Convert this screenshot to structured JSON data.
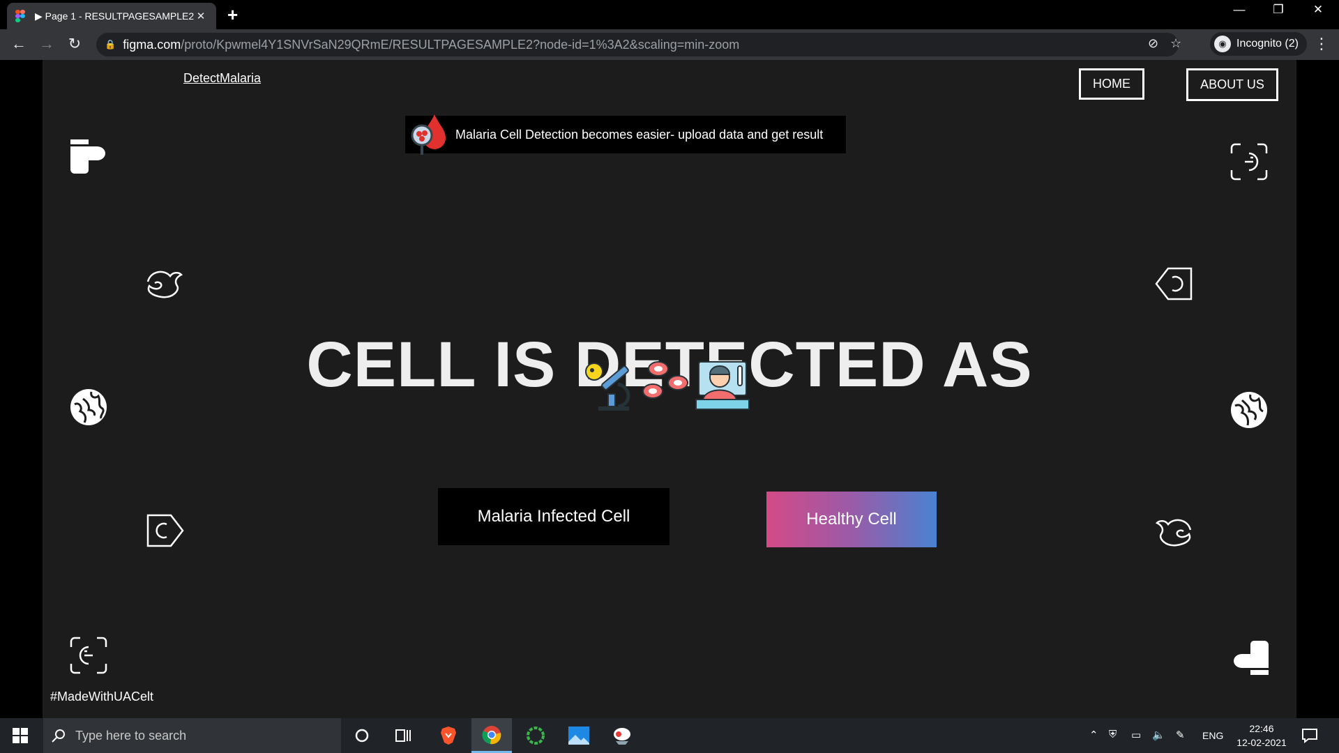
{
  "browser": {
    "tab_title": "▶ Page 1 - RESULTPAGESAMPLE2",
    "tab_close": "✕",
    "new_tab": "+",
    "url_host": "figma.com",
    "url_path": "/proto/Kpwmel4Y1SNVrSaN29QRmE/RESULTPAGESAMPLE2?node-id=1%3A2&scaling=min-zoom",
    "profile_label": "Incognito (2)",
    "window_controls": [
      "—",
      "❐",
      "✕"
    ]
  },
  "page": {
    "brand": "DetectMalaria",
    "nav": {
      "home": "HOME",
      "about": "ABOUT US"
    },
    "banner_text": "Malaria Cell Detection becomes easier- upload data and get result",
    "headline": "CELL IS DETECTED AS",
    "buttons": {
      "infected": "Malaria Infected Cell",
      "healthy": "Healthy Cell"
    },
    "footer_tag": "#MadeWithUACelt",
    "colors": {
      "frame_bg": "#1c1c1c",
      "healthy_gradient": [
        "#d44a87",
        "#4a82d1"
      ]
    }
  },
  "taskbar": {
    "search_placeholder": "Type here to search",
    "language": "ENG",
    "time": "22:46",
    "date": "12-02-2021",
    "pinned_icons": [
      "cortana-icon",
      "task-view-icon",
      "brave-icon",
      "chrome-icon",
      "refresh-app-icon",
      "photos-icon",
      "app-icon"
    ]
  }
}
